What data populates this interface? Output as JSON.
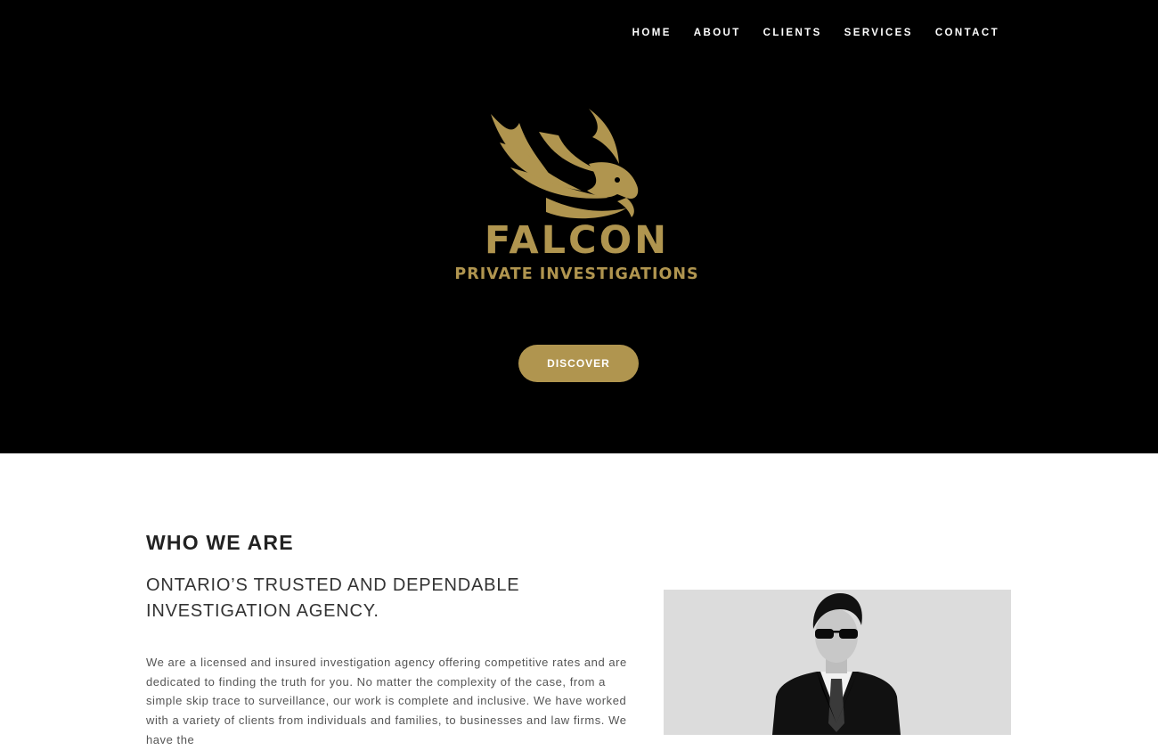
{
  "nav": {
    "items": [
      {
        "label": "HOME"
      },
      {
        "label": "ABOUT"
      },
      {
        "label": "CLIENTS"
      },
      {
        "label": "SERVICES"
      },
      {
        "label": "CONTACT"
      }
    ]
  },
  "hero": {
    "logo_word": "FALCON",
    "logo_sub": "PRIVATE INVESTIGATIONS",
    "cta_label": "DISCOVER"
  },
  "about": {
    "title": "WHO WE ARE",
    "subtitle": "ONTARIO’S TRUSTED AND DEPENDABLE INVESTIGATION AGENCY.",
    "body": "We are a licensed and insured investigation agency offering competitive rates and are dedicated to finding the truth for you. No matter the complexity of the case, from a simple skip trace to surveillance, our work is complete and inclusive. We have worked with a variety of clients from individuals and families, to businesses and law firms. We have the"
  },
  "colors": {
    "gold": "#b0954f",
    "hero_bg": "#000000",
    "photo_bg": "#dcdcdc"
  },
  "icons": {
    "logo_mark": "falcon-head-icon",
    "photo": "agent-in-sunglasses-photo"
  }
}
